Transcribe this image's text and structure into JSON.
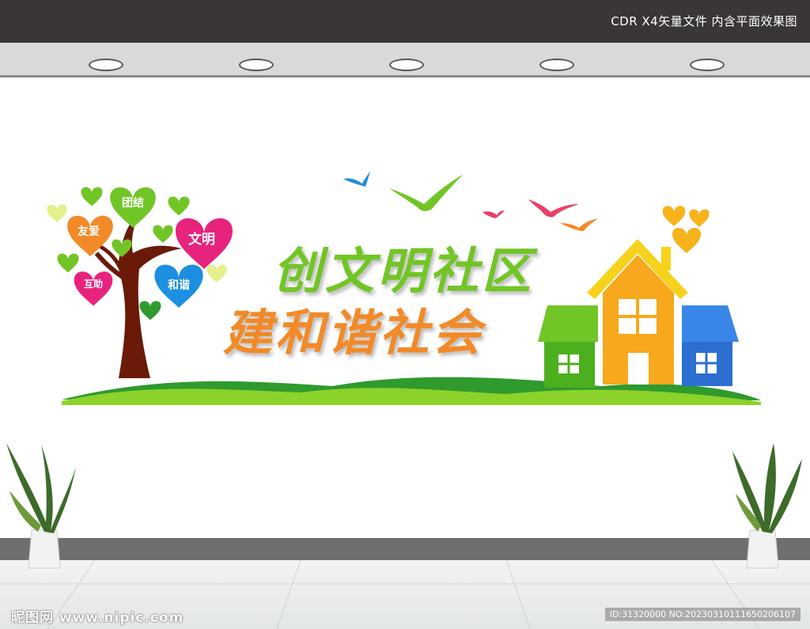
{
  "header": {
    "file_info": "CDR X4矢量文件  内含平面效果图"
  },
  "mural": {
    "title_line1": "创文明社区",
    "title_line2": "建和谐社会",
    "heart_labels": {
      "tuanjie": "团结",
      "youai": "友爱",
      "wenming": "文明",
      "huzhu": "互助",
      "hexie": "和谐"
    }
  },
  "watermark": {
    "site": "昵图网 www.nipic.com",
    "id": "ID:31320000 NO:20230310111650206107"
  },
  "colors": {
    "green": "#72c526",
    "orange": "#f28a28",
    "pink": "#e8237d",
    "blue": "#1d8fe0",
    "lime": "#e4f08a",
    "house_blue": "#3a86e8",
    "house_yellow": "#f7b21c"
  },
  "icons": [
    "ceiling-light-icon",
    "bird-icon",
    "heart-icon",
    "tree-icon",
    "house-icon",
    "plant-icon"
  ]
}
